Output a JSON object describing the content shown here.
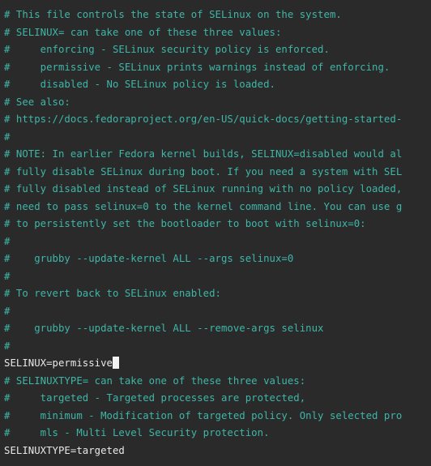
{
  "editor": {
    "lines": [
      {
        "type": "comment",
        "text": "# This file controls the state of SELinux on the system."
      },
      {
        "type": "comment",
        "text": "# SELINUX= can take one of these three values:"
      },
      {
        "type": "comment",
        "text": "#     enforcing - SELinux security policy is enforced."
      },
      {
        "type": "comment",
        "text": "#     permissive - SELinux prints warnings instead of enforcing."
      },
      {
        "type": "comment",
        "text": "#     disabled - No SELinux policy is loaded."
      },
      {
        "type": "comment",
        "text": "# See also:"
      },
      {
        "type": "comment",
        "text": "# https://docs.fedoraproject.org/en-US/quick-docs/getting-started-"
      },
      {
        "type": "comment",
        "text": "#"
      },
      {
        "type": "comment",
        "text": "# NOTE: In earlier Fedora kernel builds, SELINUX=disabled would al"
      },
      {
        "type": "comment",
        "text": "# fully disable SELinux during boot. If you need a system with SEL"
      },
      {
        "type": "comment",
        "text": "# fully disabled instead of SELinux running with no policy loaded,"
      },
      {
        "type": "comment",
        "text": "# need to pass selinux=0 to the kernel command line. You can use g"
      },
      {
        "type": "comment",
        "text": "# to persistently set the bootloader to boot with selinux=0:"
      },
      {
        "type": "comment",
        "text": "#"
      },
      {
        "type": "comment",
        "text": "#    grubby --update-kernel ALL --args selinux=0"
      },
      {
        "type": "comment",
        "text": "#"
      },
      {
        "type": "comment",
        "text": "# To revert back to SELinux enabled:"
      },
      {
        "type": "comment",
        "text": "#"
      },
      {
        "type": "comment",
        "text": "#    grubby --update-kernel ALL --remove-args selinux"
      },
      {
        "type": "comment",
        "text": "#"
      },
      {
        "type": "plain",
        "text": "SELINUX=permissive",
        "cursor": true
      },
      {
        "type": "comment",
        "text": "# SELINUXTYPE= can take one of these three values:"
      },
      {
        "type": "comment",
        "text": "#     targeted - Targeted processes are protected,"
      },
      {
        "type": "comment",
        "text": "#     minimum - Modification of targeted policy. Only selected pro"
      },
      {
        "type": "comment",
        "text": "#     mls - Multi Level Security protection."
      },
      {
        "type": "plain",
        "text": "SELINUXTYPE=targeted"
      }
    ]
  },
  "colors": {
    "background": "#2a2a2a",
    "comment": "#3fb6a8",
    "plain": "#e8e8e8",
    "cursor": "#f2f2f2"
  }
}
